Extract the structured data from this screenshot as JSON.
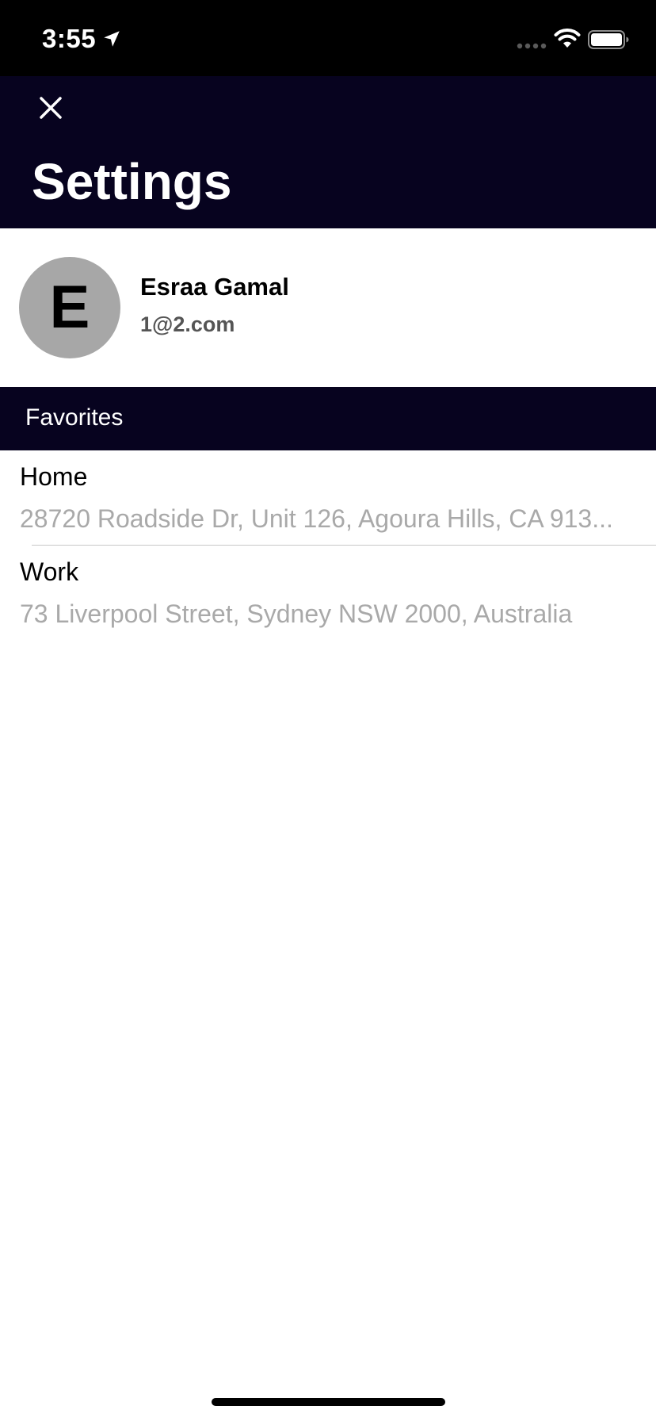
{
  "status_bar": {
    "time": "3:55",
    "icons": [
      "location-arrow-icon",
      "cellular-dots-icon",
      "wifi-icon",
      "battery-icon"
    ]
  },
  "header": {
    "close_icon": "close-icon",
    "title": "Settings",
    "background_color": "#07031f"
  },
  "profile": {
    "avatar_initial": "E",
    "avatar_color": "#a7a7a7",
    "name": "Esraa Gamal",
    "email": "1@2.com"
  },
  "favorites": {
    "section_title": "Favorites",
    "items": [
      {
        "label": "Home",
        "address": "28720 Roadside Dr, Unit 126, Agoura Hills, CA  913..."
      },
      {
        "label": "Work",
        "address": "73 Liverpool Street, Sydney NSW 2000, Australia"
      }
    ]
  }
}
